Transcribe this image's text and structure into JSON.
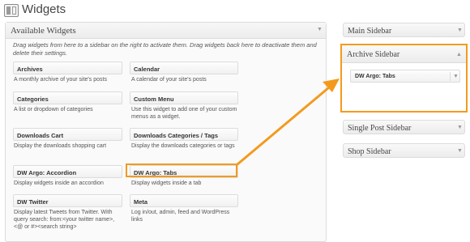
{
  "header": {
    "title": "Widgets",
    "icon": "widgets-icon"
  },
  "available": {
    "title": "Available Widgets",
    "description": "Drag widgets from here to a sidebar on the right to activate them. Drag widgets back here to deactivate them and delete their settings.",
    "widgets": [
      {
        "name": "Archives",
        "desc": "A monthly archive of your site's posts"
      },
      {
        "name": "Calendar",
        "desc": "A calendar of your site's posts"
      },
      {
        "name": "Categories",
        "desc": "A list or dropdown of categories"
      },
      {
        "name": "Custom Menu",
        "desc": "Use this widget to add one of your custom menus as a widget."
      },
      {
        "name": "Downloads Cart",
        "desc": "Display the downloads shopping cart"
      },
      {
        "name": "Downloads Categories / Tags",
        "desc": "Display the downloads categories or tags"
      },
      {
        "name": "DW Argo: Accordion",
        "desc": "Display widgets inside an accordion"
      },
      {
        "name": "DW Argo: Tabs",
        "desc": "Display widgets inside a tab"
      },
      {
        "name": "DW Twitter",
        "desc": "Display latest Tweets from Twitter. With query search: from:<your twitter name>, <@ or #><search string>"
      },
      {
        "name": "Meta",
        "desc": "Log in/out, admin, feed and WordPress links"
      }
    ]
  },
  "sidebars": {
    "main": "Main Sidebar",
    "archive": "Archive Sidebar",
    "archive_widget": "DW Argo: Tabs",
    "single_post": "Single Post Sidebar",
    "shop": "Shop Sidebar"
  },
  "colors": {
    "highlight": "#f39a1e",
    "border": "#dcdcdc"
  }
}
